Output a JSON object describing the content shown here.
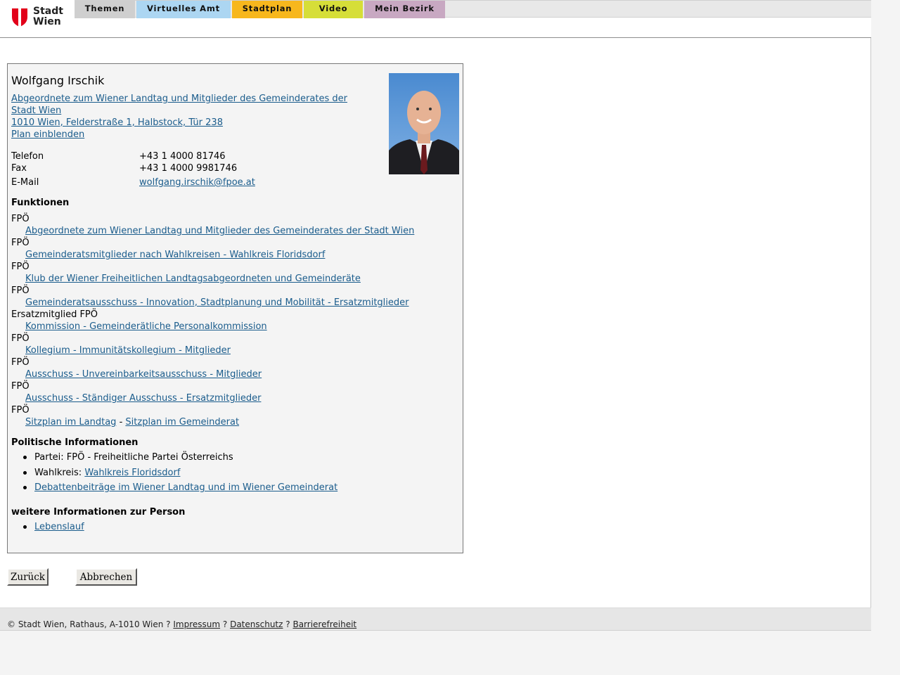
{
  "logo": {
    "line1": "Stadt",
    "line2": "Wien"
  },
  "nav": {
    "tabs": [
      {
        "label": "Themen",
        "color": "#cfcfcf"
      },
      {
        "label": "Virtuelles Amt",
        "color": "#acd6f2"
      },
      {
        "label": "Stadtplan",
        "color": "#f7b71d"
      },
      {
        "label": "Video",
        "color": "#d6de38"
      },
      {
        "label": "Mein Bezirk",
        "color": "#c8a8c2"
      }
    ]
  },
  "person": {
    "name": "Wolfgang Irschik",
    "office_line1": "Abgeordnete zum Wiener Landtag und Mitglieder des Gemeinderates der",
    "office_line2": "Stadt Wien ",
    "address": "1010 Wien, Felderstraße 1, Halbstock, Tür 238",
    "plan_link": "Plan einblenden",
    "contact": [
      {
        "label": "Telefon",
        "value": "+43 1 4000 81746"
      },
      {
        "label": "Fax",
        "value": "+43 1 4000 9981746"
      },
      {
        "label": "E-Mail",
        "value": "wolfgang.irschik@fpoe.at"
      }
    ]
  },
  "functions": {
    "title": "Funktionen",
    "items": [
      {
        "party": "FPÖ",
        "link": "Abgeordnete zum Wiener Landtag und Mitglieder des Gemeinderates der Stadt Wien"
      },
      {
        "party": "FPÖ",
        "link": "Gemeinderatsmitglieder nach Wahlkreisen - Wahlkreis Floridsdorf"
      },
      {
        "party": "FPÖ",
        "link": "Klub der Wiener Freiheitlichen Landtagsabgeordneten und Gemeinderäte"
      },
      {
        "party": "FPÖ",
        "link": "Gemeinderatsausschuss - Innovation, Stadtplanung und Mobilität - Ersatzmitglieder"
      },
      {
        "party": "Ersatzmitglied FPÖ",
        "link": "Kommission - Gemeinderätliche Personalkommission"
      },
      {
        "party": "FPÖ",
        "link": "Kollegium - Immunitätskollegium - Mitglieder"
      },
      {
        "party": "FPÖ",
        "link": "Ausschuss - Unvereinbarkeitsausschuss - Mitglieder"
      },
      {
        "party": "FPÖ",
        "link": "Ausschuss - Ständiger Ausschuss - Ersatzmitglieder"
      },
      {
        "party": "FPÖ"
      }
    ],
    "seating": {
      "landtag": "Sitzplan im Landtag",
      "separator": "-",
      "gemeinderat": "Sitzplan im Gemeinderat"
    }
  },
  "political": {
    "title": "Politische Informationen",
    "party_label": "Partei: FPÖ - Freiheitliche Partei Österreichs",
    "district_prefix": "Wahlkreis: ",
    "district_link": "Wahlkreis Floridsdorf",
    "debates_link": "Debattenbeiträge im Wiener Landtag und im Wiener Gemeinderat"
  },
  "further": {
    "title": "weitere Informationen zur Person",
    "cv_link": "Lebenslauf"
  },
  "buttons": {
    "back": "Zurück",
    "cancel": "Abbrechen"
  },
  "footer": {
    "copyright": "© Stadt Wien, Rathaus, A-1010 Wien",
    "sep": "?",
    "impressum": "Impressum",
    "datenschutz": "Datenschutz",
    "barrierefreiheit": "Barrierefreiheit"
  }
}
